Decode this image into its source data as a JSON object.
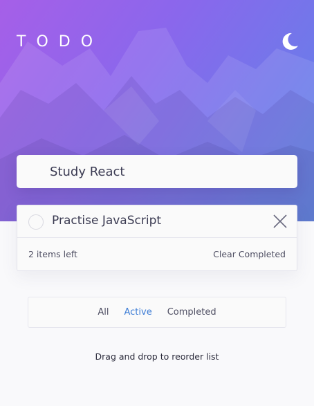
{
  "header": {
    "title": "TODO",
    "theme_icon": "moon-icon"
  },
  "new_todo": {
    "value": "Study React"
  },
  "todos": [
    {
      "text": "Practise JavaScript",
      "completed": false
    }
  ],
  "footer": {
    "items_left": "2 items left",
    "clear_label": "Clear Completed"
  },
  "filters": {
    "all": "All",
    "active": "Active",
    "completed": "Completed",
    "selected": "Active"
  },
  "hint": "Drag and drop to reorder list",
  "colors": {
    "accent": "#3a7bd5",
    "gradient_start": "#a65fe8",
    "gradient_end": "#5a87e6",
    "text": "#3b3b52"
  }
}
